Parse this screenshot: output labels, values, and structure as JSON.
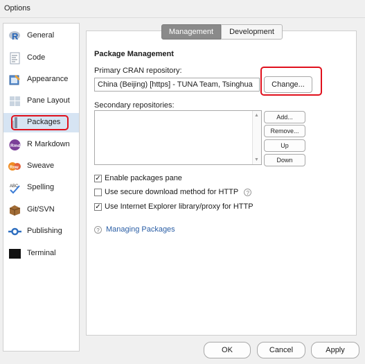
{
  "window": {
    "title": "Options"
  },
  "sidebar": {
    "items": [
      {
        "label": "General",
        "icon": "r-logo-icon"
      },
      {
        "label": "Code",
        "icon": "code-icon"
      },
      {
        "label": "Appearance",
        "icon": "appearance-icon"
      },
      {
        "label": "Pane Layout",
        "icon": "pane-layout-icon"
      },
      {
        "label": "Packages",
        "icon": "packages-icon",
        "selected": true
      },
      {
        "label": "R Markdown",
        "icon": "rmarkdown-icon"
      },
      {
        "label": "Sweave",
        "icon": "sweave-icon"
      },
      {
        "label": "Spelling",
        "icon": "spelling-icon"
      },
      {
        "label": "Git/SVN",
        "icon": "git-icon"
      },
      {
        "label": "Publishing",
        "icon": "publishing-icon"
      },
      {
        "label": "Terminal",
        "icon": "terminal-icon"
      }
    ]
  },
  "tabs": {
    "management": "Management",
    "development": "Development",
    "active": "management"
  },
  "packages": {
    "section_title": "Package Management",
    "primary_label": "Primary CRAN repository:",
    "primary_value": "China (Beijing) [https] - TUNA Team, Tsinghua",
    "change_button": "Change...",
    "secondary_label": "Secondary repositories:",
    "add_button": "Add...",
    "remove_button": "Remove...",
    "up_button": "Up",
    "down_button": "Down",
    "options": [
      {
        "label": "Enable packages pane",
        "checked": true
      },
      {
        "label": "Use secure download method for HTTP",
        "checked": false,
        "help": true
      },
      {
        "label": "Use Internet Explorer library/proxy for HTTP",
        "checked": true
      }
    ],
    "help_link": "Managing Packages"
  },
  "footer": {
    "ok": "OK",
    "cancel": "Cancel",
    "apply": "Apply"
  },
  "colors": {
    "highlight": "#e0101c",
    "selected_bg": "#d6e4f3",
    "link": "#2a5ea5"
  }
}
